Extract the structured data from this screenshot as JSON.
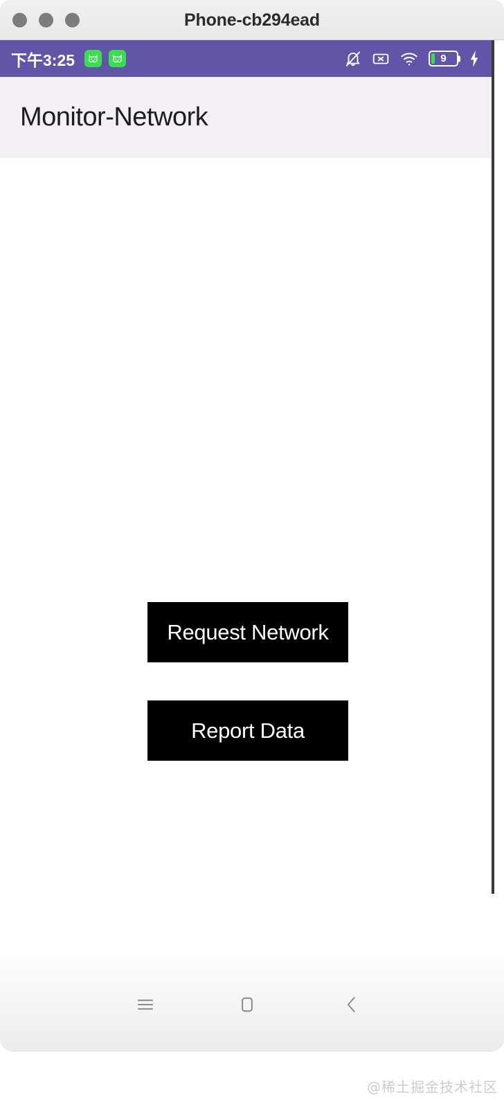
{
  "window": {
    "title": "Phone-cb294ead",
    "traffic_lights": [
      "close",
      "minimize",
      "maximize"
    ]
  },
  "status_bar": {
    "clock": "下午3:25",
    "background_color": "#6155a8",
    "notification_icons": [
      {
        "name": "android-app-notification-1",
        "color": "#3ddc54"
      },
      {
        "name": "android-app-notification-2",
        "color": "#3ddc54"
      }
    ],
    "system_icons": [
      {
        "name": "notifications-muted-icon"
      },
      {
        "name": "no-sim-card-icon"
      },
      {
        "name": "wifi-icon"
      }
    ],
    "battery": {
      "level_label": "9",
      "charging": true,
      "fill_color": "#3ddc54"
    }
  },
  "app_bar": {
    "title": "Monitor-Network",
    "background_color": "#f3eff5",
    "text_color": "#1c1b1f"
  },
  "content": {
    "buttons": [
      {
        "label": "Request Network",
        "name": "request-network-button"
      },
      {
        "label": "Report Data",
        "name": "report-data-button"
      }
    ],
    "button_background_color": "#000000",
    "button_text_color": "#ffffff"
  },
  "navigation_bar": {
    "items": [
      {
        "name": "recents-button",
        "icon": "menu-icon"
      },
      {
        "name": "home-button",
        "icon": "square-icon"
      },
      {
        "name": "back-button",
        "icon": "chevron-left-icon"
      }
    ]
  },
  "watermark": {
    "text": "@稀土掘金技术社区"
  }
}
